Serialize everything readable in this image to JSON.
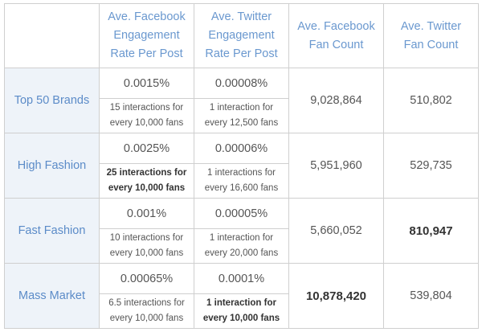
{
  "headers": [
    "",
    "Ave. Facebook\nEngagement\nRate Per Post",
    "Ave. Twitter\nEngagement\nRate Per Post",
    "Ave. Facebook\nFan Count",
    "Ave. Twitter\nFan Count"
  ],
  "rows": [
    {
      "label": "Top 50 Brands",
      "fb_rate": "0.0015%",
      "tw_rate": "0.00008%",
      "fb_interactions": "15 interactions for\nevery 10,000 fans",
      "tw_interactions": "1 interaction for\nevery 12,500 fans",
      "fb_fans": "9,028,864",
      "tw_fans": "510,802"
    },
    {
      "label": "High Fashion",
      "fb_rate": "0.0025%",
      "tw_rate": "0.00006%",
      "fb_interactions": "25 interactions for\nevery 10,000 fans",
      "tw_interactions": "1 interactions for\nevery 16,600 fans",
      "fb_fans": "5,951,960",
      "tw_fans": "529,735"
    },
    {
      "label": "Fast Fashion",
      "fb_rate": "0.001%",
      "tw_rate": "0.00005%",
      "fb_interactions": "10 interactions for\nevery 10,000 fans",
      "tw_interactions": "1 interaction for\nevery 20,000 fans",
      "fb_fans": "5,660,052",
      "tw_fans": "810,947"
    },
    {
      "label": "Mass Market",
      "fb_rate": "0.00065%",
      "tw_rate": "0.0001%",
      "fb_interactions": "6.5 interactions for\nevery 10,000 fans",
      "tw_interactions": "1 interaction for\nevery 10,000 fans",
      "fb_fans": "10,878,420",
      "tw_fans": "539,804"
    }
  ]
}
